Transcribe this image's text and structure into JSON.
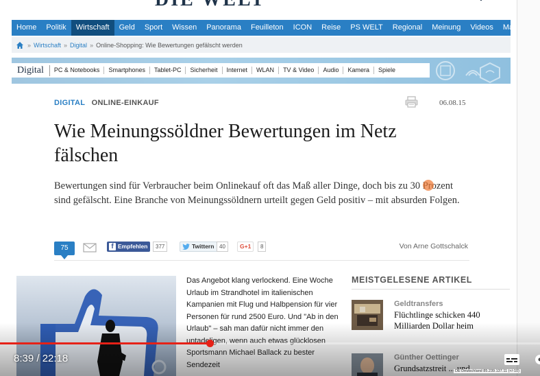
{
  "site": {
    "logo_text": "DIE WELT"
  },
  "nav": {
    "items": [
      "Home",
      "Politik",
      "Wirtschaft",
      "Geld",
      "Sport",
      "Wissen",
      "Panorama",
      "Feuilleton",
      "ICON",
      "Reise",
      "PS WELT",
      "Regional",
      "Meinung",
      "Videos",
      "Markt"
    ],
    "active": "Wirtschaft"
  },
  "breadcrumb": {
    "crumbs": [
      "Wirtschaft",
      "Digital"
    ],
    "current": "Online-Shopping: Wie Bewertungen gefälscht werden"
  },
  "section": {
    "title": "Digital",
    "subnav": [
      "PC & Notebooks",
      "Smartphones",
      "Tablet-PC",
      "Sicherheit",
      "Internet",
      "WLAN",
      "TV & Video",
      "Audio",
      "Kamera",
      "Spiele"
    ]
  },
  "article": {
    "kicker_section": "DIGITAL",
    "kicker_topic": "ONLINE-EINKAUF",
    "date": "06.08.15",
    "headline": "Wie Meinungssöldner Bewertungen im Netz fälschen",
    "lead": "Bewertungen sind für Verbraucher beim Onlinekauf oft das Maß aller Dinge, doch bis zu 30 Prozent sind gefälscht. Eine Branche von Meinungssöldnern urteilt gegen Geld positiv – mit absurden Folgen.",
    "body": "Das Angebot klang verlockend. Eine Woche Urlaub im Strandhotel im italienischen Kampanien mit Flug und Halbpension für vier Personen für rund 2500 Euro. Und \"Ab in den Urlaub\" – sah man dafür nicht immer den untadeligen, wenn auch etwas glücklosen Sportsmann Michael Ballack zu bester Sendezeit",
    "author": "Von Arne Gottschalck"
  },
  "social": {
    "comments": "75",
    "facebook_label": "Empfehlen",
    "facebook_count": "377",
    "twitter_label": "Twittern",
    "twitter_count": "40",
    "gplus_label": "G+1",
    "gplus_count": "8"
  },
  "sidebar": {
    "title": "MEISTGELESENE ARTIKEL",
    "items": [
      {
        "kicker": "Geldtransfers",
        "headline": "Flüchtlinge schicken 440 Milliarden Dollar heim"
      },
      {
        "kicker": "Günther Oettinger",
        "headline": "Grundsatzstreit ... und"
      }
    ]
  },
  "video": {
    "current_time": "8:39",
    "separator": " / ",
    "duration": "22:18",
    "progress": 0.388
  },
  "status": {
    "text": "DE Deutschland 85.239.137.11 (+/-10)"
  },
  "colors": {
    "nav_blue": "#2a7fc4",
    "nav_active": "#114e7e",
    "progress_red": "#e62117",
    "facebook": "#3b5998"
  },
  "icons": [
    "home-icon",
    "print-icon",
    "mail-icon",
    "facebook-icon",
    "twitter-icon",
    "cc-icon",
    "settings-icon"
  ]
}
